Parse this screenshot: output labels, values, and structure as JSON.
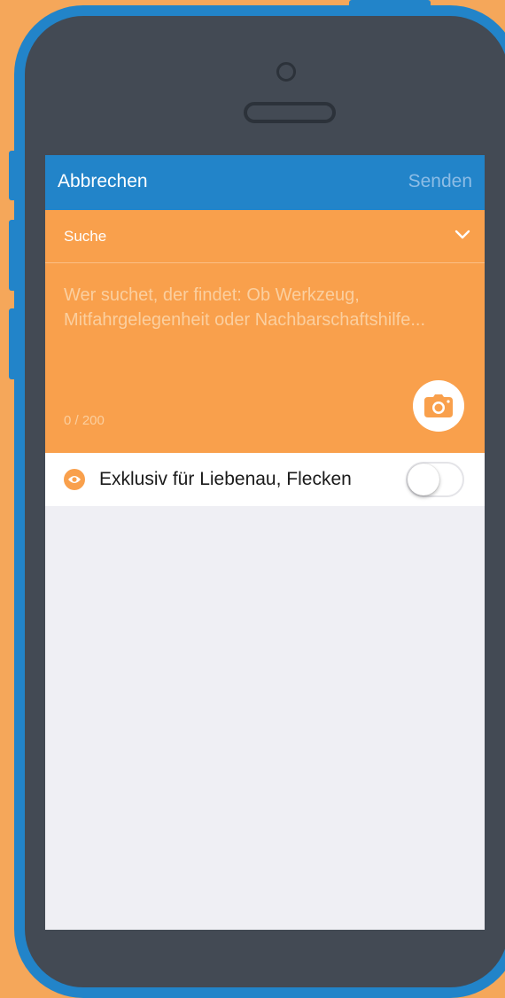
{
  "navbar": {
    "cancel_label": "Abbrechen",
    "send_label": "Senden"
  },
  "form": {
    "category": "Suche",
    "placeholder": "Wer suchet, der findet: Ob Werkzeug, Mitfahrgelegenheit oder Nachbarschaftshilfe...",
    "counter": "0 / 200"
  },
  "exclusive": {
    "label": "Exklusiv für Liebenau, Flecken",
    "enabled": false
  },
  "icons": {
    "camera": "camera-icon",
    "eye": "eye-icon",
    "chevron": "chevron-down-icon"
  },
  "colors": {
    "primary": "#2284c9",
    "accent": "#f9a04c",
    "background": "#f5a75a"
  }
}
